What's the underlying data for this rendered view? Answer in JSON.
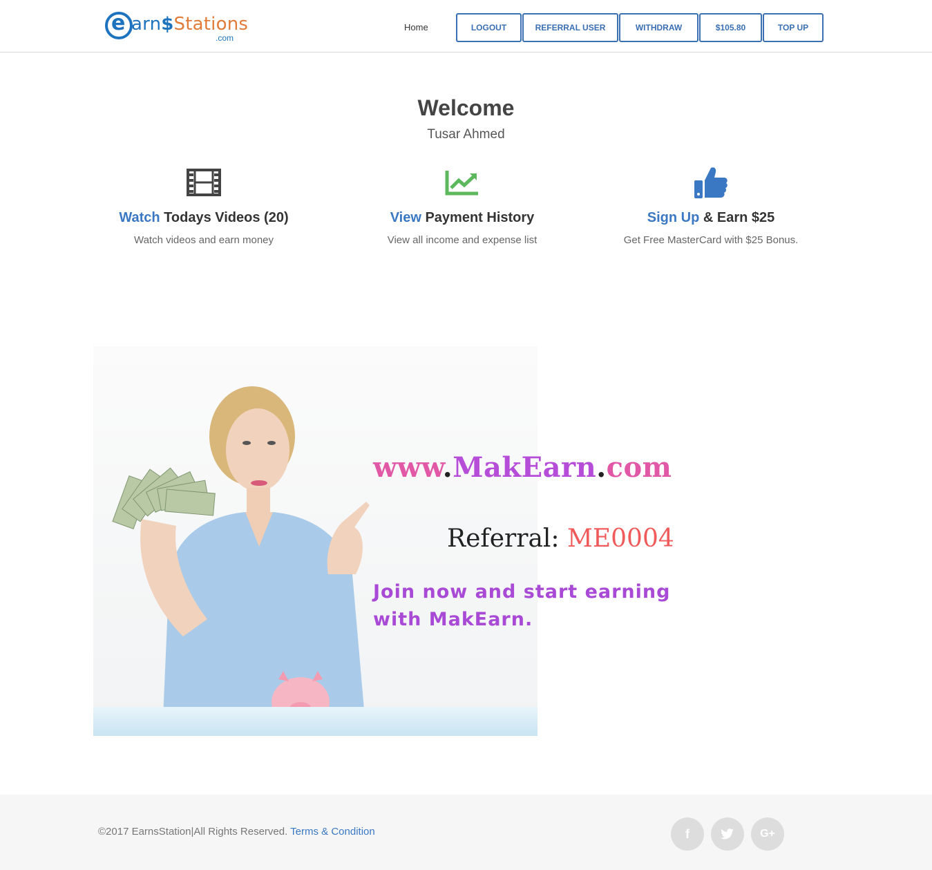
{
  "header": {
    "logo": {
      "part1": "arn",
      "part2": "Stations",
      "dollar": "$",
      "com": ".com"
    },
    "nav": {
      "home": "Home",
      "buttons": [
        "LOGOUT",
        "REFERRAL USER",
        "WITHDRAW",
        "$105.80",
        "TOP UP"
      ]
    }
  },
  "welcome": {
    "title": "Welcome",
    "username": "Tusar Ahmed"
  },
  "features": [
    {
      "icon": "film-icon",
      "link": "Watch",
      "title_rest": " Todays Videos (20)",
      "desc": "Watch videos and earn money"
    },
    {
      "icon": "area-chart-icon",
      "link": "View",
      "title_rest": " Payment History",
      "desc": "View all income and expense list"
    },
    {
      "icon": "thumbs-up-icon",
      "link": "Sign Up",
      "title_rest": " & Earn $25",
      "desc": "Get Free MasterCard with $25 Bonus."
    }
  ],
  "banner": {
    "site_prefix": "www",
    "dot1": ".",
    "site_name": "MakEarn",
    "dot2": ".",
    "site_suffix": "com",
    "ref_label": "Referral: ",
    "ref_code": "ME0004",
    "join": "Join now and start earning with MakEarn."
  },
  "footer": {
    "copyright": "©2017 EarnsStation|All Rights Reserved. ",
    "terms": "Terms & Condition",
    "social": [
      "facebook-icon",
      "twitter-icon",
      "google-plus-icon"
    ]
  },
  "colors": {
    "accent": "#3a78c3",
    "nav_border": "#3a6fb3",
    "chart_green": "#5cb85c",
    "brand_orange": "#e07b39"
  }
}
